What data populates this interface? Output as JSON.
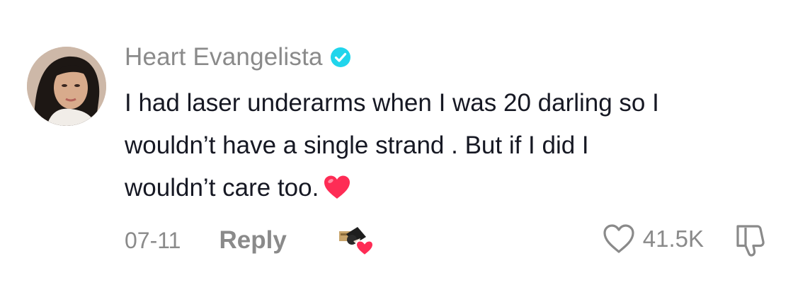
{
  "comment": {
    "author": {
      "name": "Heart Evangelista",
      "verified": true,
      "avatar_icon": "profile-photo"
    },
    "text_line1": "I had laser underarms when I was 20 darling so I",
    "text_line2": "wouldn’t have a single strand . But if I did I",
    "text_line3": "wouldn’t care too.",
    "emoji": "red-heart",
    "date": "07-11",
    "reply_label": "Reply",
    "creator_like_badge_icon": "liked-by-creator-icon",
    "like_count": "41.5K",
    "colors": {
      "verified": "#20D5EC",
      "heart": "#FE2C55",
      "muted_text": "#8A8A8A",
      "body_text": "#161823"
    }
  }
}
